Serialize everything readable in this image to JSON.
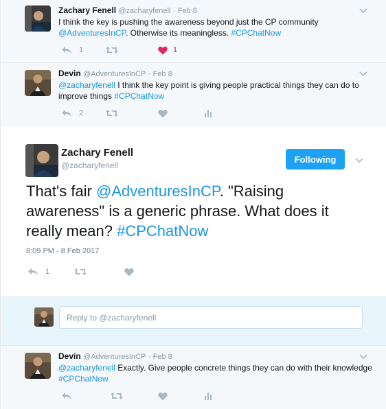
{
  "tweets": [
    {
      "name": "Zachary Fenell",
      "handle": "@zacharyfenell",
      "dot": "·",
      "date": "Feb 8",
      "text_before": "I think the key is pushing the awareness beyond just the CP community",
      "mention": "@AdventuresInCP",
      "text_after": ". Otherwise its meaningless. ",
      "hashtag": "#CPChatNow",
      "reply_count": "1",
      "retweet_count": "",
      "like_count": "1",
      "liked": true
    },
    {
      "name": "Devin",
      "handle": "@AdventuresInCP",
      "dot": "·",
      "date": "Feb 8",
      "mention": "@zacharyfenell",
      "text_after": " I think the key point is giving people practical things they can do to improve things ",
      "hashtag": "#CPChatNow",
      "reply_count": "2",
      "retweet_count": "",
      "like_count": ""
    },
    {
      "name": "Devin",
      "handle": "@AdventuresInCP",
      "dot": "·",
      "date": "Feb 8",
      "mention": "@zacharyfenell",
      "text_after": " Exactly. Give people concrete things they can do with their knowledge ",
      "hashtag": "#CPChatNow"
    }
  ],
  "focused": {
    "name": "Zachary Fenell",
    "handle": "@zacharyfenell",
    "follow_label": "Following",
    "text_before": "That's fair ",
    "mention": "@AdventuresInCP",
    "text_middle": ". \"Raising awareness\" is a generic phrase. What does it really mean? ",
    "hashtag": "#CPChatNow",
    "timestamp": "8:09 PM - 8 Feb 2017",
    "reply_count": "1"
  },
  "reply_box": {
    "placeholder": "Reply to @zacharyfenell"
  },
  "colors": {
    "link": "#1b95e0",
    "accent": "#1da1f2",
    "like": "#e0245e",
    "muted": "#8899a6",
    "thread_bg": "#f5f8fa",
    "reply_bg": "#e8f5fd"
  },
  "icons": [
    "reply-icon",
    "retweet-icon",
    "like-icon",
    "analytics-icon",
    "chevron-down-icon"
  ]
}
